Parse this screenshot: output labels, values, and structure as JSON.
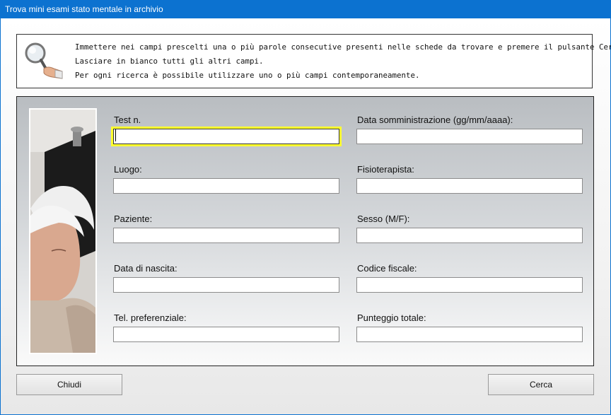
{
  "window": {
    "title": "Trova mini esami stato mentale in archivio"
  },
  "info": {
    "lines": [
      "Immettere nei campi prescelti una o più parole consecutive presenti nelle schede da trovare e premere il pulsante Cerca.",
      "Lasciare in bianco tutti gli altri campi.",
      "Per ogni ricerca è possibile utilizzare uno o più campi contemporaneamente."
    ]
  },
  "form": {
    "left": [
      {
        "label": "Test n.",
        "value": ""
      },
      {
        "label": "Luogo:",
        "value": ""
      },
      {
        "label": "Paziente:",
        "value": ""
      },
      {
        "label": "Data di nascita:",
        "value": ""
      },
      {
        "label": "Tel. preferenziale:",
        "value": ""
      }
    ],
    "right": [
      {
        "label": "Data somministrazione (gg/mm/aaaa):",
        "value": ""
      },
      {
        "label": "Fisioterapista:",
        "value": ""
      },
      {
        "label": "Sesso (M/F):",
        "value": ""
      },
      {
        "label": "Codice fiscale:",
        "value": ""
      },
      {
        "label": "Punteggio totale:",
        "value": ""
      }
    ]
  },
  "buttons": {
    "close": "Chiudi",
    "search": "Cerca"
  },
  "colors": {
    "titlebar": "#0c72d0",
    "focus_highlight": "#ffff2e"
  }
}
